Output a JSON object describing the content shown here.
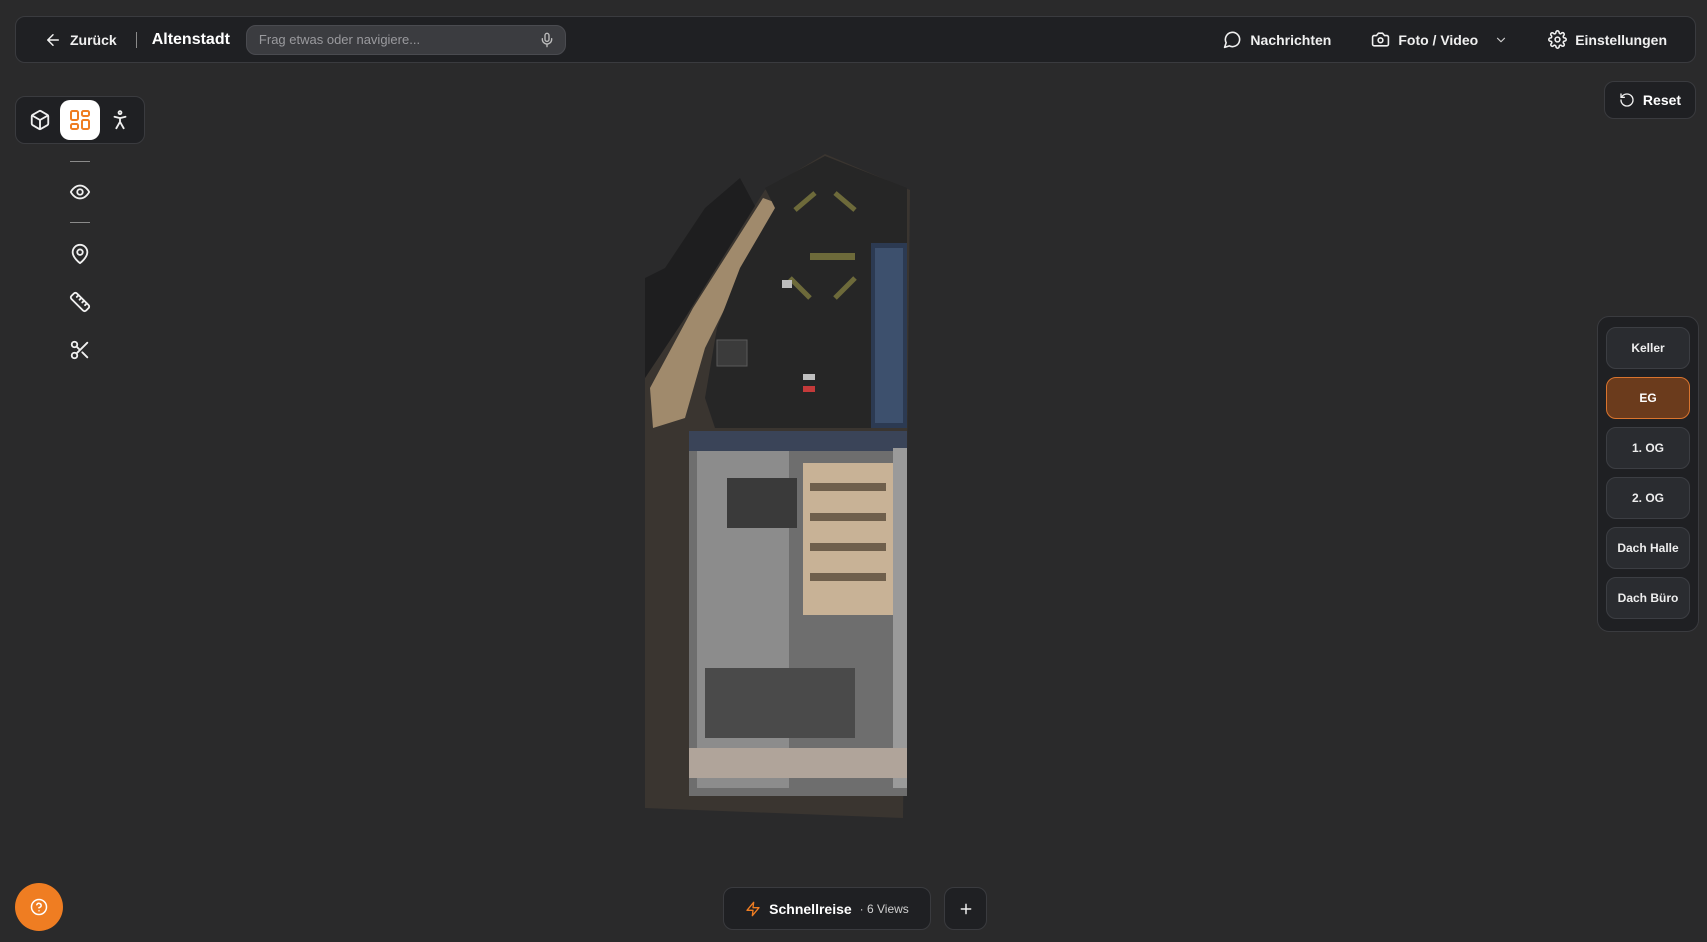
{
  "header": {
    "back_label": "Zurück",
    "project_name": "Altenstadt",
    "search_placeholder": "Frag etwas oder navigiere...",
    "messages_label": "Nachrichten",
    "media_label": "Foto / Video",
    "settings_label": "Einstellungen"
  },
  "view_modes": [
    {
      "icon": "cube-icon",
      "active": false
    },
    {
      "icon": "floorplan-grid-icon",
      "active": true
    },
    {
      "icon": "person-walk-icon",
      "active": false
    }
  ],
  "tools": [
    "eye-icon",
    "map-pin-icon",
    "ruler-icon",
    "scissors-icon"
  ],
  "reset_label": "Reset",
  "floors": {
    "items": [
      "Keller",
      "EG",
      "1. OG",
      "2. OG",
      "Dach Halle",
      "Dach Büro"
    ],
    "active": "EG"
  },
  "quick_travel": {
    "label": "Schnellreise",
    "count": "· 6 Views"
  },
  "colors": {
    "accent": "#ef7d22",
    "active_floor_bg": "#6b3b1c",
    "active_floor_border": "#d9742e",
    "panel_bg": "#1f2023",
    "canvas_bg": "#2a2a2b"
  }
}
